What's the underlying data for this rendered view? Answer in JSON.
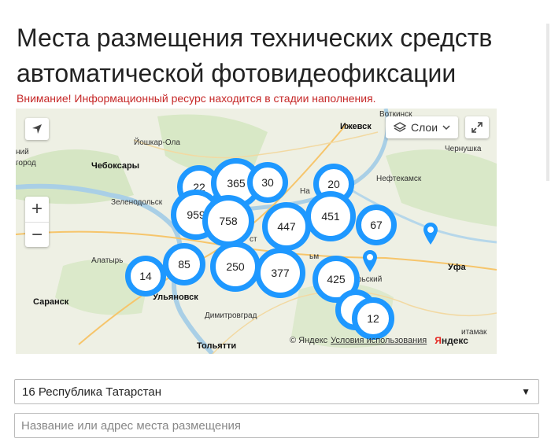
{
  "page": {
    "title": "Места размещения технических средств автоматической фотовидеофиксации",
    "warning": "Внимание! Информационный ресурс находится в стадии наполнения."
  },
  "map": {
    "controls": {
      "layers_label": "Слои",
      "zoom_in": "+",
      "zoom_out": "−"
    },
    "clusters": [
      {
        "count": "22"
      },
      {
        "count": "365"
      },
      {
        "count": "30"
      },
      {
        "count": "20"
      },
      {
        "count": "959"
      },
      {
        "count": "758"
      },
      {
        "count": "447"
      },
      {
        "count": "451"
      },
      {
        "count": "67"
      },
      {
        "count": "14"
      },
      {
        "count": "85"
      },
      {
        "count": "250"
      },
      {
        "count": "377"
      },
      {
        "count": "425"
      },
      {
        "count": "12"
      }
    ],
    "places": {
      "votkinsk": "Воткинск",
      "izhevsk": "Ижевск",
      "yoshkar_ola": "Йошкар-Ола",
      "cheboksary": "Чебоксары",
      "chernushka": "Чернушка",
      "neftekamsk": "Нефтекамск",
      "zelenodolsk": "Зеленодольск",
      "alatyr": "Алатырь",
      "saransk": "Саранск",
      "ulyanovsk": "Ульяновск",
      "dimitrovgrad": "Димитровград",
      "tolyatti": "Тольятти",
      "ufa": "Уфа",
      "nizhny_part": "ний",
      "gorod_part": "город",
      "na_part": "На",
      "st_part": "ст",
      "ny_part": "ьм",
      "rsky_part": "рьский",
      "tamak_part": "итамак"
    },
    "attribution": {
      "copyright": "© Яндекс",
      "terms": "Условия использования",
      "brand_first": "Я",
      "brand_rest": "ндекс"
    }
  },
  "filters": {
    "region_selected": "16 Республика Татарстан",
    "search_placeholder": "Название или адрес места размещения"
  },
  "colors": {
    "cluster_ring": "#1e98ff",
    "warning": "#c62828"
  }
}
